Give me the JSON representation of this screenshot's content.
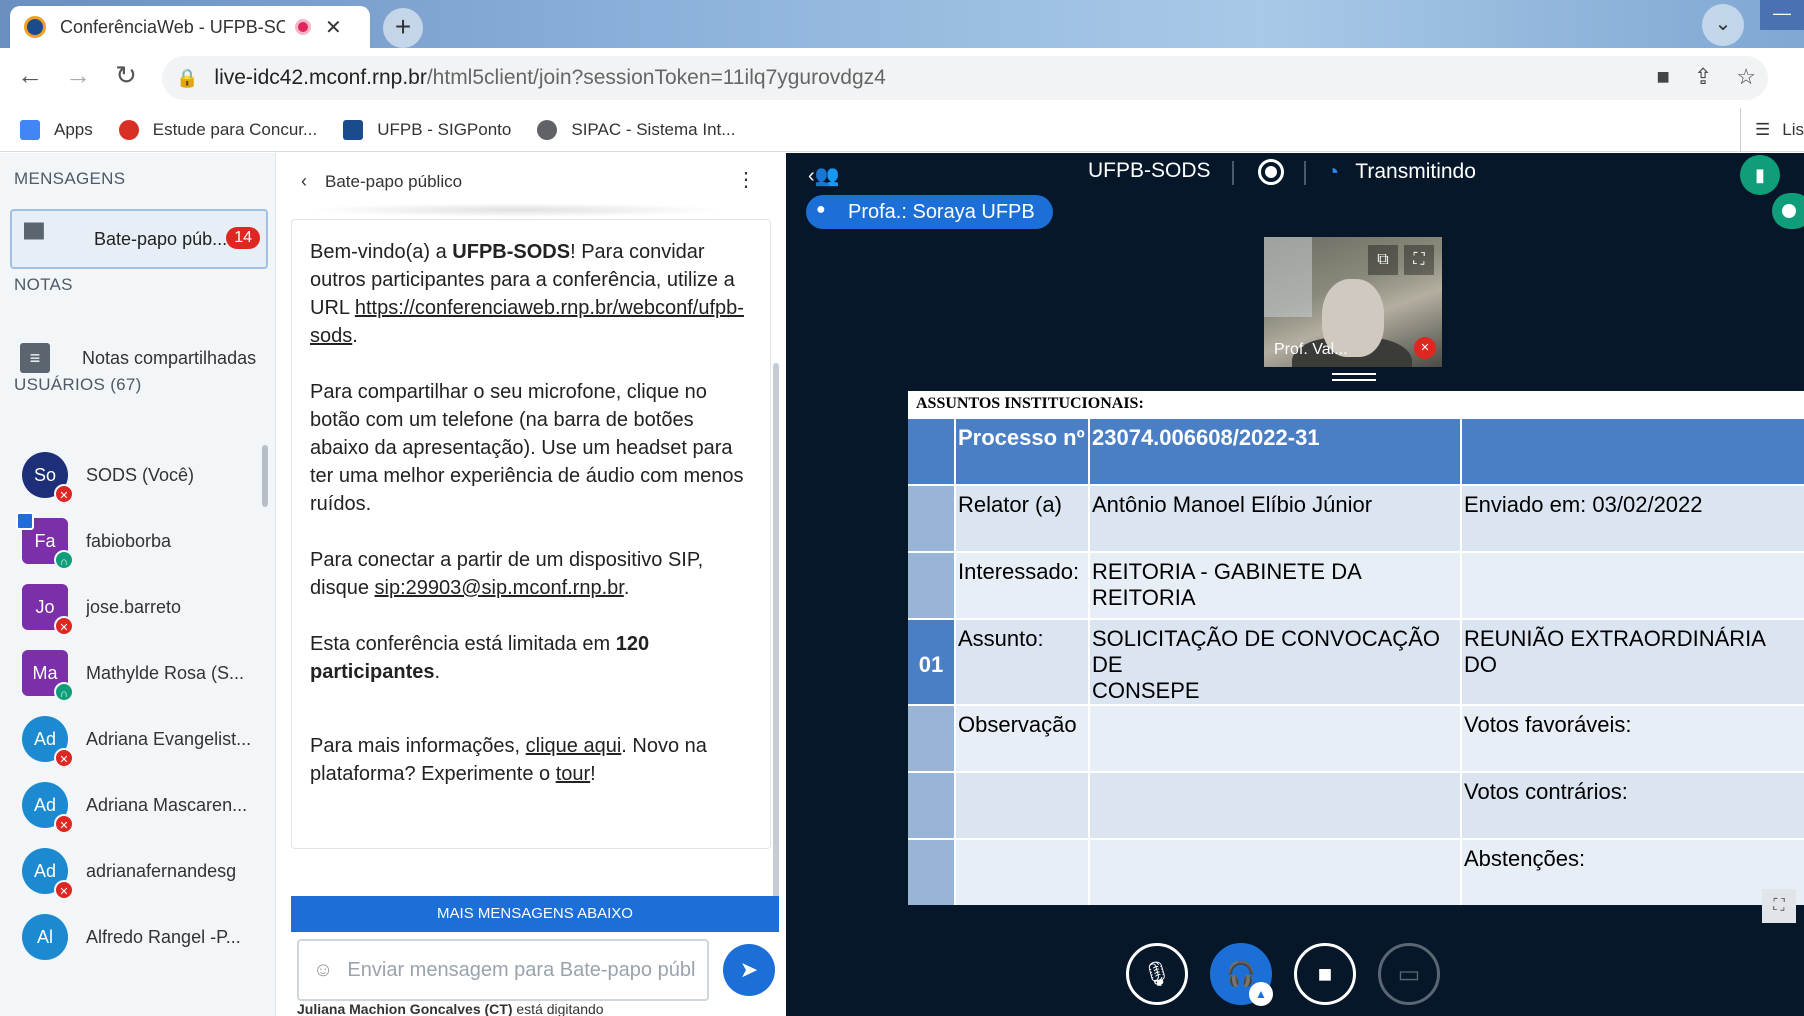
{
  "browser": {
    "tab_title": "ConferênciaWeb - UFPB-SOI",
    "url_host": "live-idc42.mconf.rnp.br",
    "url_path": "/html5client/join?sessionToken=11ilq7ygurovdgz4",
    "bookmarks": [
      {
        "label": "Apps",
        "color": "#4285f4"
      },
      {
        "label": "Estude para Concur...",
        "color": "#d93025"
      },
      {
        "label": "UFPB - SIGPonto",
        "color": "#1a4b8c"
      },
      {
        "label": "SIPAC - Sistema Int...",
        "color": "#5f6368"
      }
    ],
    "reading_list": "Lis"
  },
  "sidebar": {
    "messages_title": "MENSAGENS",
    "chat_label": "Bate-papo púb...",
    "chat_badge": "14",
    "notes_title": "NOTAS",
    "notes_label": "Notas compartilhadas",
    "users_title": "USUÁRIOS (67)",
    "users": [
      {
        "initials": "So",
        "name": "SODS (Você)",
        "color": "#1e2f7a",
        "status": "mute",
        "square": false
      },
      {
        "initials": "Fa",
        "name": "fabioborba",
        "color": "#7b2fa8",
        "status": "listen",
        "square": true
      },
      {
        "initials": "Jo",
        "name": "jose.barreto",
        "color": "#7b2fa8",
        "status": "mute",
        "square": true
      },
      {
        "initials": "Ma",
        "name": "Mathylde Rosa (S...",
        "color": "#7b2fa8",
        "status": "listen",
        "square": true
      },
      {
        "initials": "Ad",
        "name": "Adriana Evangelist...",
        "color": "#1b8ad0",
        "status": "mute",
        "square": false
      },
      {
        "initials": "Ad",
        "name": "Adriana Mascaren...",
        "color": "#1b8ad0",
        "status": "mute",
        "square": false
      },
      {
        "initials": "Ad",
        "name": "adrianafernandesg",
        "color": "#1b8ad0",
        "status": "mute",
        "square": false
      },
      {
        "initials": "Al",
        "name": "Alfredo Rangel -P...",
        "color": "#1b8ad0",
        "status": "none",
        "square": false
      }
    ]
  },
  "chat": {
    "header": "Bate-papo público",
    "welcome": {
      "p1_pre": "Bem-vindo(a) a ",
      "p1_bold": "UFPB-SODS",
      "p1_post": "! Para convidar outros participantes para a conferência, utilize a URL ",
      "p1_link": "https://conferenciaweb.rnp.br/webconf/ufpb-sods",
      "p2": "Para compartilhar o seu microfone, clique no botão com um telefone (na barra de botões abaixo da apresentação). Use um headset para ter uma melhor experiência de áudio com menos ruídos.",
      "p3_pre": "Para conectar a partir de um dispositivo SIP, disque ",
      "p3_link": "sip:29903@sip.mconf.rnp.br",
      "p4_pre": "Esta conferência está limitada em ",
      "p4_bold": "120 participantes",
      "p5_pre": "Para mais informações, ",
      "p5_link": "clique aqui",
      "p5_mid": ". Novo na plataforma? Experimente o ",
      "p5_link2": "tour"
    },
    "more_messages": "MAIS MENSAGENS ABAIXO",
    "input_placeholder": "Enviar mensagem para Bate-papo públ",
    "typing_user": "Juliana Machion Goncalves (CT)",
    "typing_text": "está digitando"
  },
  "stage": {
    "meeting_name": "UFPB-SODS",
    "streaming": "Transmitindo",
    "talker": "Profa.: Soraya UFPB",
    "webcam_name": "Prof. Val..."
  },
  "slide": {
    "heading": "ASSUNTOS INSTITUCIONAIS:",
    "item_number": "01",
    "rows": [
      {
        "c1": "Processo nº",
        "c2": "23074.006608/2022-31",
        "c3": ""
      },
      {
        "c1": "Relator (a)",
        "c2": "Antônio Manoel Elíbio Júnior",
        "c3": "Enviado em: 03/02/2022"
      },
      {
        "c1": "Interessado:",
        "c2": "REITORIA - GABINETE DA REITORIA",
        "c3": ""
      },
      {
        "c1": "Assunto:",
        "c2": "SOLICITAÇÃO DE CONVOCAÇÃO DE",
        "c3": "REUNIÃO EXTRAORDINÁRIA DO",
        "c2b": "CONSEPE"
      },
      {
        "c1": "Observação",
        "c2": "",
        "c3": "Votos favoráveis:"
      },
      {
        "c1": "",
        "c2": "",
        "c3": "Votos contrários:"
      },
      {
        "c1": "",
        "c2": "",
        "c3": "Abstenções:"
      }
    ]
  }
}
